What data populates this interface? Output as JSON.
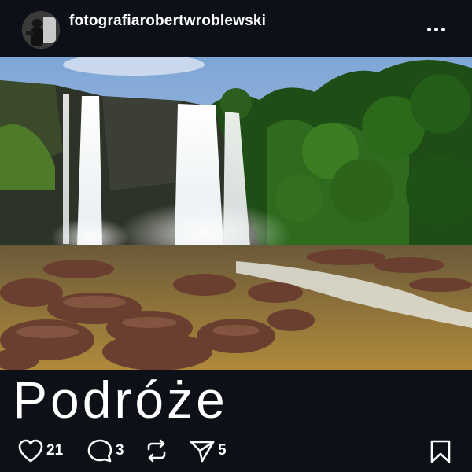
{
  "post": {
    "username": "fotografiarobertwroblewski",
    "caption": "Podróże"
  },
  "actions": {
    "likes": "21",
    "comments": "3",
    "shares": "5"
  },
  "icons": {
    "more": "more-options-icon",
    "like": "heart-icon",
    "comment": "comment-bubble-icon",
    "repost": "repost-icon",
    "send": "send-icon",
    "save": "bookmark-icon"
  }
}
